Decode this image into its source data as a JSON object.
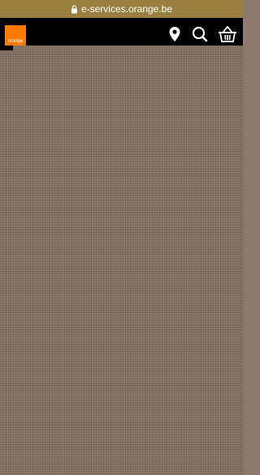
{
  "browser": {
    "url": "e-services.orange.be"
  },
  "header": {
    "logo_text": "orange",
    "icons": [
      "location-icon",
      "search-icon",
      "basket-icon"
    ]
  },
  "colors": {
    "brand": "#ff7900",
    "header_bg": "#000000",
    "overlay": "#8e7c6d"
  }
}
